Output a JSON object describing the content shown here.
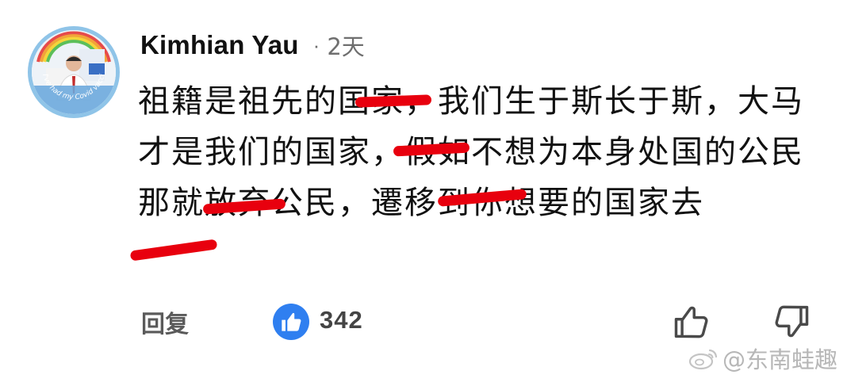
{
  "comment": {
    "author": "Kimhian Yau",
    "separator": "·",
    "timestamp": "2天",
    "avatar_frame_text": "I've had my Covid vaccine",
    "text": "祖籍是祖先的国家，我们生于斯长于斯，大马才是我们的国家，假如不想为本身处国的公民那就放弃公民，遷移到你想要的国家去",
    "actions": {
      "reply_label": "回复",
      "like_count": "342"
    }
  },
  "watermark": {
    "text": "@东南蛙趣"
  },
  "colors": {
    "like_badge": "#2f7ff0",
    "redaction_marks": "#e8000e",
    "secondary_text": "#6f6f6f"
  }
}
